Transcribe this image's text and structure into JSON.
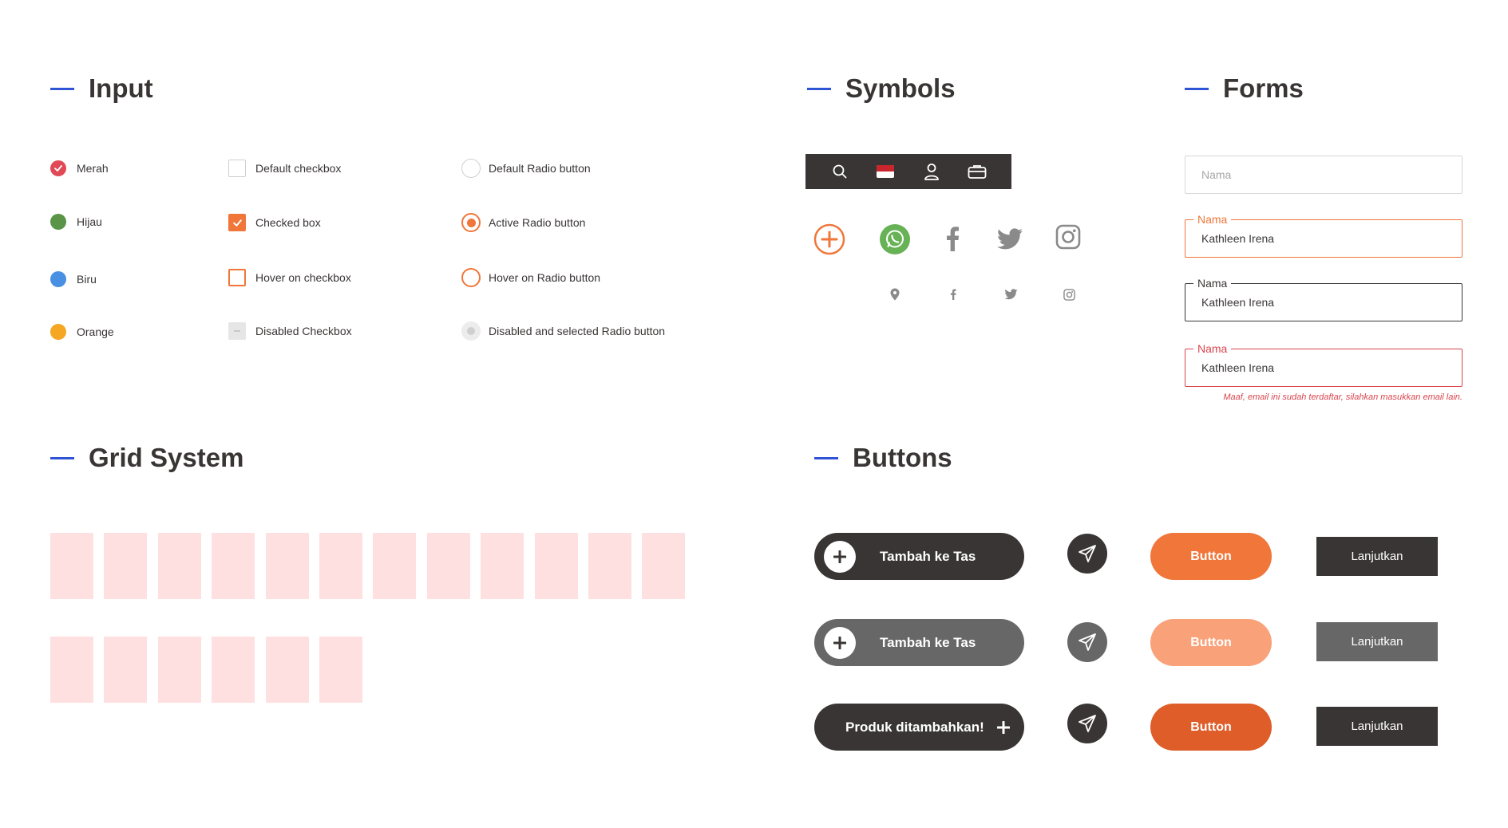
{
  "sections": {
    "input": "Input",
    "symbols": "Symbols",
    "forms": "Forms",
    "grid": "Grid System",
    "buttons": "Buttons"
  },
  "colors": {
    "accent_line": "#2f54d6",
    "dark": "#3a3535",
    "orange": "#f0763a",
    "orange_light": "#f9a27a",
    "orange_dark": "#de5d28",
    "error": "#d9454e",
    "grid_cell": "#ffe0e1"
  },
  "input": {
    "color_options": [
      {
        "label": "Merah",
        "color": "#e04a56",
        "checked": true
      },
      {
        "label": "Hijau",
        "color": "#5a9447",
        "checked": false
      },
      {
        "label": "Biru",
        "color": "#4a90e2",
        "checked": false
      },
      {
        "label": "Orange",
        "color": "#f5a623",
        "checked": false
      }
    ],
    "checkboxes": [
      {
        "label": "Default checkbox",
        "state": "default"
      },
      {
        "label": "Checked box",
        "state": "checked"
      },
      {
        "label": "Hover on checkbox",
        "state": "hover"
      },
      {
        "label": "Disabled Checkbox",
        "state": "disabled"
      }
    ],
    "radios": [
      {
        "label": "Default Radio button",
        "state": "default"
      },
      {
        "label": "Active Radio button",
        "state": "active"
      },
      {
        "label": "Hover on Radio button",
        "state": "hover"
      },
      {
        "label": "Disabled and selected Radio button",
        "state": "disabled-selected"
      }
    ]
  },
  "symbols": {
    "navbar_icons": [
      "search-icon",
      "flag-icon",
      "user-icon",
      "bag-icon"
    ],
    "large_icons": [
      "add-circle-icon",
      "whatsapp-icon",
      "facebook-icon",
      "twitter-icon",
      "instagram-icon"
    ],
    "small_icons": [
      "location-pin-icon",
      "facebook-icon",
      "twitter-icon",
      "instagram-icon"
    ]
  },
  "forms": {
    "placeholder": "Nama",
    "field_label": "Nama",
    "field_value": "Kathleen Irena",
    "error_message": "Maaf, email ini sudah terdaftar, silahkan masukkan email lain."
  },
  "grid": {
    "row1_count": 12,
    "row2_count": 6
  },
  "buttons": {
    "add_to_bag": "Tambah ke Tas",
    "product_added": "Produk ditambahkan!",
    "generic": "Button",
    "continue": "Lanjutkan"
  }
}
